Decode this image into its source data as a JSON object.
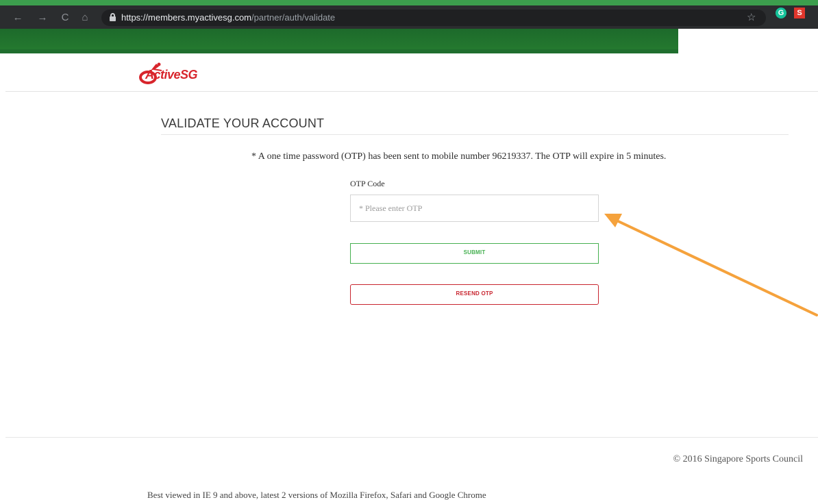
{
  "browser": {
    "url_host": "https://members.myactivesg.com",
    "url_path": "/partner/auth/validate",
    "back_glyph": "←",
    "forward_glyph": "→",
    "reload_glyph": "C",
    "home_glyph": "⌂",
    "star_glyph": "☆",
    "ext_g_letter": "G",
    "ext_s_letter": "S",
    "icons": [
      "back-icon",
      "forward-icon",
      "reload-icon",
      "home-icon",
      "lock-icon",
      "star-icon",
      "grammarly-extension-icon",
      "s-extension-icon"
    ]
  },
  "site": {
    "logo_text": "ActiveSG",
    "brand_color": "#d8252c"
  },
  "page": {
    "title": "VALIDATE YOUR ACCOUNT",
    "notice": "* A one time password (OTP) has been sent to mobile number 96219337. The OTP will expire in 5 minutes.",
    "otp_label": "OTP Code",
    "otp_placeholder": "* Please enter OTP",
    "otp_value": "",
    "submit_label": "SUBMIT",
    "resend_label": "RESEND OTP",
    "submit_color": "#45b050",
    "resend_color": "#c8242e"
  },
  "footer": {
    "copyright": "© 2016 Singapore Sports Council",
    "best_viewed": "Best viewed in IE 9 and above, latest 2 versions of Mozilla Firefox, Safari and Google Chrome"
  },
  "annotation": {
    "arrow_color": "#f5a23c"
  }
}
